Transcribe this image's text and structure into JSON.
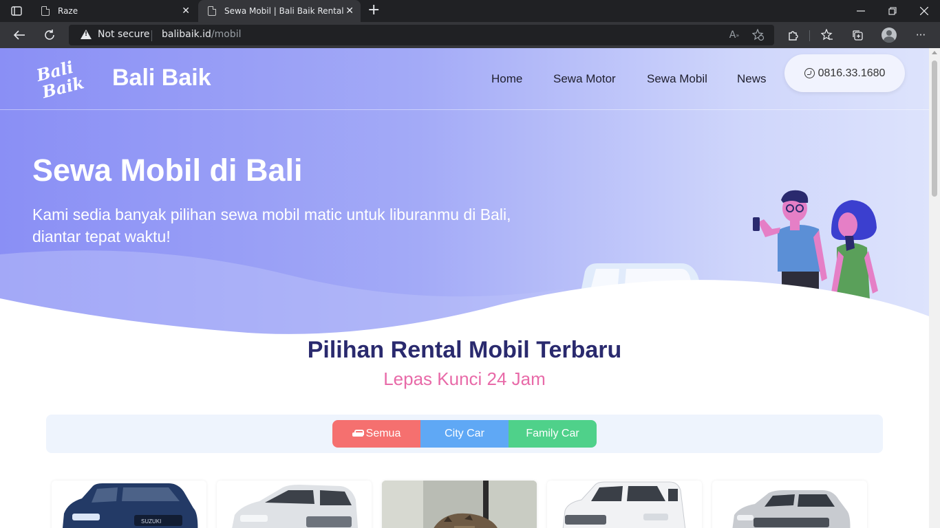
{
  "browser": {
    "tabs": [
      {
        "title": "Raze",
        "active": false
      },
      {
        "title": "Sewa Mobil | Bali Baik Rental",
        "active": true
      }
    ],
    "security_label": "Not secure",
    "url_host": "balibaik.id",
    "url_path": "/mobil",
    "icons": [
      "tab-actions-icon",
      "page-icon",
      "close-icon",
      "new-tab-icon",
      "minimize-icon",
      "restore-icon",
      "window-close-icon",
      "back-icon",
      "reload-icon",
      "warning-icon",
      "read-aloud-icon",
      "add-favorite-icon",
      "extensions-icon",
      "favorites-icon",
      "collections-icon",
      "profile-icon",
      "more-icon"
    ]
  },
  "header": {
    "logo_text": "Bali Baik",
    "brand": "Bali Baik",
    "nav": [
      {
        "label": "Home"
      },
      {
        "label": "Sewa Motor"
      },
      {
        "label": "Sewa Mobil"
      },
      {
        "label": "News"
      }
    ],
    "phone": "0816.33.1680"
  },
  "hero": {
    "title": "Sewa Mobil di Bali",
    "subtitle": "Kami sedia banyak pilihan sewa mobil matic untuk liburanmu di Bali, diantar tepat waktu!"
  },
  "section": {
    "title": "Pilihan Rental Mobil Terbaru",
    "subtitle": "Lepas Kunci 24 Jam"
  },
  "filters": [
    {
      "label": "Semua",
      "icon": "car-icon",
      "color": "#f5706f",
      "active": true
    },
    {
      "label": "City Car",
      "color": "#5fa8f5",
      "active": false
    },
    {
      "label": "Family Car",
      "color": "#4fd18a",
      "active": false
    }
  ],
  "cards": [
    {
      "image": "blue-suv-photo"
    },
    {
      "image": "silver-mpv-photo"
    },
    {
      "image": "cat-photo"
    },
    {
      "image": "white-van-photo"
    },
    {
      "image": "silver-hatchback-photo"
    }
  ],
  "colors": {
    "accent_title": "#2a2a6e",
    "accent_pink": "#e86aa8",
    "hero_gradient_start": "#8a8ff5",
    "hero_gradient_end": "#dde3fc"
  }
}
